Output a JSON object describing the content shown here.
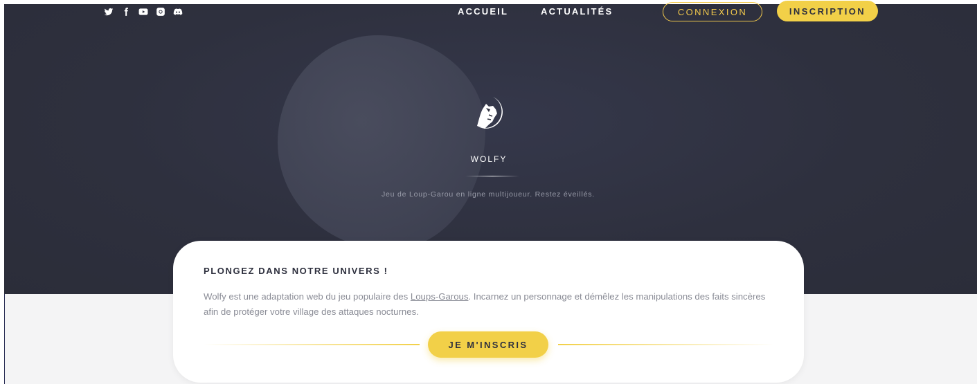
{
  "social": [
    "twitter-icon",
    "facebook-icon",
    "youtube-icon",
    "instagram-icon",
    "discord-icon"
  ],
  "nav": {
    "home": "ACCUEIL",
    "news": "ACTUALITÉS",
    "login": "CONNEXION",
    "signup": "INSCRIPTION"
  },
  "hero": {
    "brand": "WOLFY",
    "tagline": "Jeu de Loup-Garou en ligne multijoueur. Restez éveillés."
  },
  "card": {
    "title": "PLONGEZ DANS NOTRE UNIVERS !",
    "text_before": "Wolfy est une adaptation web du jeu populaire des ",
    "text_link": "Loups-Garous",
    "text_after": ". Incarnez un personnage et démêlez les manipulations des faits sincères afin de protéger votre village des attaques nocturnes.",
    "cta": "JE M'INSCRIS"
  },
  "colors": {
    "accent": "#f2d048",
    "hero_bg": "#2e303e",
    "lower_bg": "#f4f4f5"
  }
}
